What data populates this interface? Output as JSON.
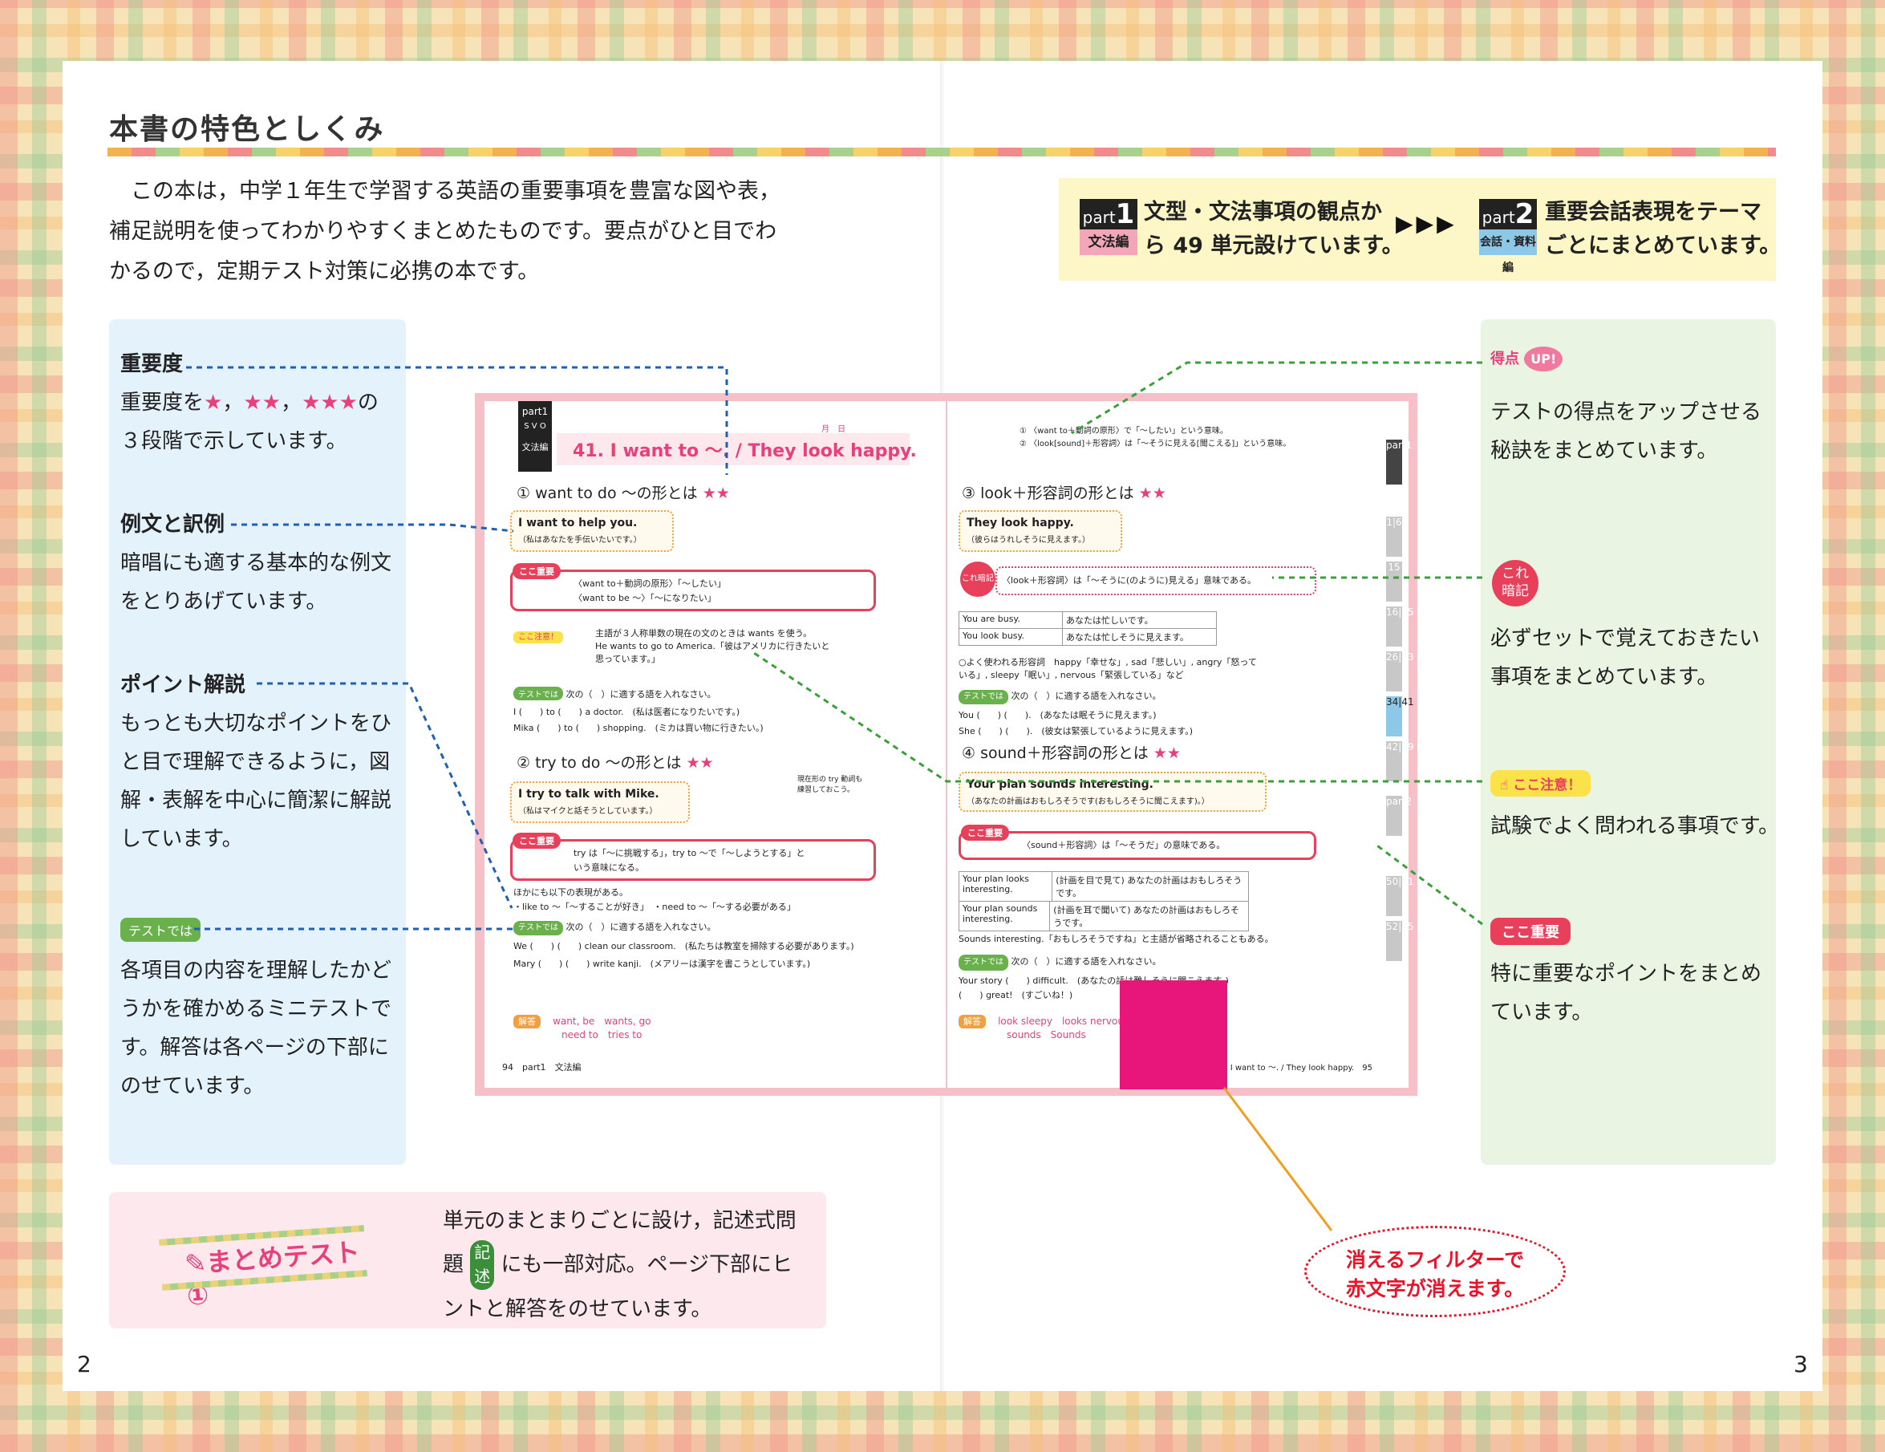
{
  "title": "本書の特色としくみ",
  "intro": [
    "　この本は，中学１年生で学習する英語の重要事項を豊富な図や表，",
    "補足説明を使ってわかりやすくまとめたものです。要点がひと目でわ",
    "かるので，定期テスト対策に必携の本です。"
  ],
  "parts": {
    "part1": {
      "label": "part",
      "num": "1",
      "sub": "文法編",
      "text": [
        "文型・文法事項の観点か",
        "ら 49 単元設けています。"
      ]
    },
    "arrows": "▶▶▶",
    "part2": {
      "label": "part",
      "num": "2",
      "sub": "会話・資料編",
      "text": [
        "重要会話表現をテーマ",
        "ごとにまとめています。"
      ]
    }
  },
  "left_panel": {
    "importance": {
      "head": "重要度",
      "l1a": "重要度を",
      "s1": "★",
      "c1": "，",
      "s2": "★★",
      "c2": "，",
      "s3": "★★★",
      "l1b": "の",
      "l2": "３段階で示しています。"
    },
    "examples": {
      "head": "例文と訳例",
      "lines": [
        "暗唱にも適する基本的な例文",
        "をとりあげています。"
      ]
    },
    "points": {
      "head": "ポイント解説",
      "lines": [
        "もっとも大切なポイントをひ",
        "と目で理解できるように，図",
        "解・表解を中心に簡潔に解説",
        "しています。"
      ]
    },
    "test": {
      "tag": "テストでは",
      "lines": [
        "各項目の内容を理解したかど",
        "うかを確かめるミニテストで",
        "す。解答は各ページの下部に",
        "のせています。"
      ]
    }
  },
  "right_panel": {
    "tokuten": {
      "tag_a": "得点",
      "tag_b": "UP!",
      "lines": [
        "テストの得点をアップさせる",
        "秘訣をまとめています。"
      ]
    },
    "kore": {
      "tag_a": "これ",
      "tag_b": "暗記",
      "lines": [
        "必ずセットで覚えておきたい",
        "事項をまとめています。"
      ]
    },
    "koko_chui": {
      "tag": "ここ注意！",
      "lines": [
        "試験でよく問われる事項です。"
      ]
    },
    "koko_juyo": {
      "tag": "ここ重要",
      "lines": [
        "特に重要なポイントをまとめ",
        "ています。"
      ]
    }
  },
  "summary": {
    "label": "まとめテスト①",
    "lines_a": "単元のまとまりごとに設け，記述式問",
    "line_b1": "題",
    "badge_a": "記",
    "badge_b": "述",
    "line_b2": "にも一部対応。ページ下部にヒ",
    "lines_c": "ントと解答をのせています。"
  },
  "filter_bubble": [
    "消えるフィルターで",
    "赤文字が消えます。"
  ],
  "page_numbers": {
    "left": "2",
    "right": "3"
  },
  "book": {
    "part_tag": "part1",
    "part_sub": "文法編",
    "svo": "S V O",
    "unit_title": "41. I want to ～. / They look happy.",
    "date_label": "月　日",
    "s1_head": "want to do ～の形とは",
    "s1_stars": "★★",
    "s1_ex1": "I want to help you.",
    "s1_ex1_jp": "（私はあなたを手伝いたいです。）",
    "kj_tag": "ここ重要",
    "kj1_l1": "〈want to＋動詞の原形〉「～したい」",
    "kj1_l2": "〈want to be ～〉「～になりたい」",
    "chui_tag": "ここ注意！",
    "chui_l1": "主語が３人称単数の現在の文のときは wants を使う。",
    "chui_l2": "He wants to go to America.「彼はアメリカに行きたいと",
    "chui_l3": "思っています。」",
    "test_tag": "テストでは",
    "test1_head": "次の（　）に適する語を入れなさい。",
    "test1_q1": "I (　　) to (　　) a doctor.　(私は医者になりたいです。)",
    "test1_q2": "Mika (　　) to (　　) shopping.　(ミカは買い物に行きたい。)",
    "s2_head": "try to do ～の形とは",
    "s2_stars": "★★",
    "s2_note": "現在形の try 動詞も練習しておこう。",
    "s2_ex": "I try to talk with Mike.",
    "s2_ex_jp": "（私はマイクと話そうとしています。）",
    "kj2_l1": "try は「～に挑戦する」，try to ～で「～しようとする」と",
    "kj2_l2": "いう意味になる。",
    "other_head": "ほかにも以下の表現がある。",
    "other_line": "・like to ～「～することが好き」　・need to ～「～する必要がある」",
    "test2_head": "次の（　）に適する語を入れなさい。",
    "test2_q1": "We (　　) (　　) clean our classroom.　(私たちは教室を掃除する必要があります。)",
    "test2_q2": "Mary (　　) (　　) write kanji.　(メアリーは漢字を書こうとしています。)",
    "ans_tag": "解答",
    "ans1": "want, be　wants, go",
    "ans2": "need to　tries to",
    "foot_l_num": "94",
    "foot_l_part": "part1",
    "foot_l_sub": "文法編",
    "tok_l1": "① 〈want to＋動詞の原形〉で「～したい」という意味。",
    "tok_l2": "② 〈look[sound]＋形容詞〉は「～そうに見える[聞こえる]」という意味。",
    "s3_head": "look＋形容詞の形とは",
    "s3_stars": "★★",
    "s3_ex": "They look happy.",
    "s3_ex_jp": "（彼らはうれしそうに見えます。）",
    "kore_tag": "これ暗記",
    "kore_l": "〈look＋形容詞〉は「～そうに(のように)見える」意味である。",
    "tbl1_r1a": "You are busy.",
    "tbl1_r1b": "あなたは忙しいです。",
    "tbl1_r2a": "You look busy.",
    "tbl1_r2b": "あなたは忙しそうに見えます。",
    "adj_l1": "○よく使われる形容詞　happy「幸せな」, sad「悲しい」, angry「怒って",
    "adj_l2": "いる」, sleepy「眠い」, nervous「緊張している」など",
    "test3_head": "次の（　）に適する語を入れなさい。",
    "test3_q1": "You (　　) (　　).　(あなたは眠そうに見えます。)",
    "test3_q2": "She (　　) (　　).　(彼女は緊張しているように見えます。)",
    "s4_head": "sound＋形容詞の形とは",
    "s4_stars": "★★",
    "s4_ex": "Your plan sounds interesting.",
    "s4_ex_jp": "（あなたの計画はおもしろそうです(おもしろそうに聞こえます)。）",
    "kj3_l": "〈sound＋形容詞〉は「～そうだ」の意味である。",
    "tbl2_r1a": "Your plan looks interesting.",
    "tbl2_r1b": "(計画を目で見て) あなたの計画はおもしろそうです。",
    "tbl2_r2a": "Your plan sounds interesting.",
    "tbl2_r2b": "(計画を耳で聞いて) あなたの計画はおもしろそうです。",
    "sounds_note": "Sounds interesting.「おもしろそうですね」と主語が省略されることもある。",
    "test4_head": "次の（　）に適する語を入れなさい。",
    "test4_q1": "Your story (　　) difficult.　(あなたの話は難しそうに聞こえます。)",
    "test4_q2": "(　　) great!　(すごいね！)",
    "ans3": "look sleepy　looks nervous",
    "ans4": "sounds　Sounds",
    "foot_r_num": "95",
    "foot_r_unit": "41　I want to ～. / They look happy.",
    "tabs": [
      "part1",
      "1|6",
      "15",
      "16|25",
      "26|33",
      "34|41",
      "42|49",
      "part2",
      "50|51",
      "52|55"
    ]
  },
  "colors": {
    "accent_pink": "#e8407b",
    "leader_blue": "#1f5fb5",
    "leader_green": "#3aa13a",
    "filter": "#e8157a",
    "orange_line": "#f0a020"
  }
}
